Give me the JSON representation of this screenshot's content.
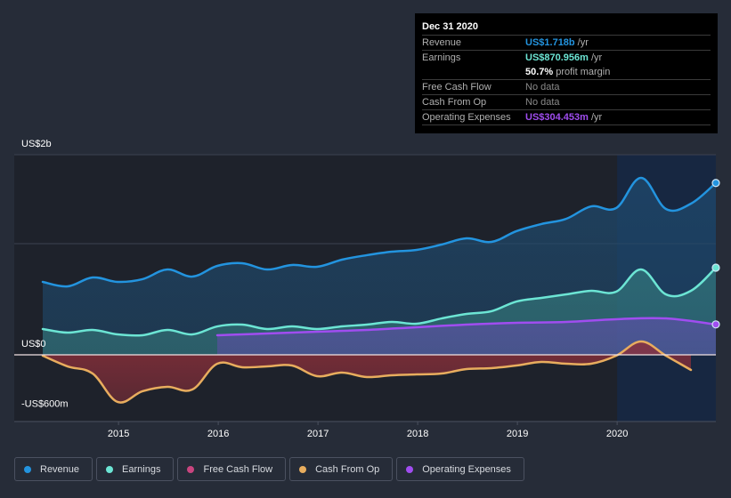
{
  "tooltip": {
    "date": "Dec 31 2020",
    "rows": [
      {
        "label": "Revenue",
        "value": "US$1.718b",
        "unit": "/yr",
        "color": "#2394df"
      },
      {
        "label": "Earnings",
        "value": "US$870.956m",
        "unit": "/yr",
        "color": "#6ce5d4"
      },
      {
        "label": "",
        "value": "50.7%",
        "unit": "profit margin",
        "color": "#ffffff"
      },
      {
        "label": "Free Cash Flow",
        "value": "No data",
        "unit": "",
        "color": "#8a8a8a"
      },
      {
        "label": "Cash From Op",
        "value": "No data",
        "unit": "",
        "color": "#8a8a8a"
      },
      {
        "label": "Operating Expenses",
        "value": "US$304.453m",
        "unit": "/yr",
        "color": "#a04df0"
      }
    ]
  },
  "legend": [
    {
      "label": "Revenue",
      "color": "#2394df"
    },
    {
      "label": "Earnings",
      "color": "#6ce5d4"
    },
    {
      "label": "Free Cash Flow",
      "color": "#c9457f"
    },
    {
      "label": "Cash From Op",
      "color": "#e8ad5e"
    },
    {
      "label": "Operating Expenses",
      "color": "#a04df0"
    }
  ],
  "chart_data": {
    "type": "line",
    "title": "",
    "xlabel": "",
    "ylabel": "",
    "y_unit": "US$ billions",
    "ylim": [
      -0.667,
      2.0
    ],
    "xlim": [
      2014.24,
      2020.99
    ],
    "y_tick_labels": [
      {
        "value": 2.0,
        "label": "US$2b"
      },
      {
        "value": 0.0,
        "label": "US$0"
      },
      {
        "value": -0.6,
        "label": "-US$600m"
      }
    ],
    "gridlines": [
      2.0,
      1.111,
      0.0
    ],
    "x_ticks": [
      2015,
      2016,
      2017,
      2018,
      2019,
      2020
    ],
    "forecast_region_start": 2020.0,
    "highlight_date": "Dec 31 2020",
    "series": [
      {
        "name": "Revenue",
        "color": "#2394df",
        "x": [
          2014.24,
          2014.49,
          2014.74,
          2014.99,
          2015.24,
          2015.49,
          2015.74,
          2015.99,
          2016.24,
          2016.49,
          2016.74,
          2016.99,
          2017.24,
          2017.49,
          2017.74,
          2017.99,
          2018.24,
          2018.49,
          2018.74,
          2018.99,
          2019.24,
          2019.49,
          2019.74,
          2019.99,
          2020.24,
          2020.49,
          2020.74,
          2020.99
        ],
        "values": [
          0.729,
          0.684,
          0.773,
          0.729,
          0.756,
          0.853,
          0.782,
          0.889,
          0.916,
          0.853,
          0.898,
          0.88,
          0.951,
          0.996,
          1.031,
          1.049,
          1.102,
          1.164,
          1.129,
          1.236,
          1.307,
          1.36,
          1.484,
          1.467,
          1.769,
          1.458,
          1.511,
          1.718
        ]
      },
      {
        "name": "Earnings",
        "color": "#6ce5d4",
        "x": [
          2014.24,
          2014.49,
          2014.74,
          2014.99,
          2015.24,
          2015.49,
          2015.74,
          2015.99,
          2016.24,
          2016.49,
          2016.74,
          2016.99,
          2017.24,
          2017.49,
          2017.74,
          2017.99,
          2018.24,
          2018.49,
          2018.74,
          2018.99,
          2019.24,
          2019.49,
          2019.74,
          2019.99,
          2020.24,
          2020.49,
          2020.74,
          2020.99
        ],
        "values": [
          0.258,
          0.222,
          0.249,
          0.204,
          0.196,
          0.249,
          0.204,
          0.284,
          0.302,
          0.258,
          0.284,
          0.258,
          0.284,
          0.302,
          0.329,
          0.311,
          0.364,
          0.409,
          0.436,
          0.533,
          0.569,
          0.604,
          0.64,
          0.631,
          0.853,
          0.604,
          0.64,
          0.871
        ]
      },
      {
        "name": "Free Cash Flow",
        "color": "#c9457f",
        "x": [],
        "values": []
      },
      {
        "name": "Cash From Op",
        "color": "#e8ad5e",
        "x": [
          2014.24,
          2014.49,
          2014.74,
          2014.99,
          2015.24,
          2015.49,
          2015.74,
          2015.99,
          2016.24,
          2016.49,
          2016.74,
          2016.99,
          2017.24,
          2017.49,
          2017.74,
          2017.99,
          2018.24,
          2018.49,
          2018.74,
          2018.99,
          2019.24,
          2019.49,
          2019.74,
          2019.99,
          2020.24,
          2020.49,
          2020.74
        ],
        "values": [
          -0.009,
          -0.116,
          -0.187,
          -0.471,
          -0.364,
          -0.32,
          -0.347,
          -0.089,
          -0.124,
          -0.116,
          -0.107,
          -0.213,
          -0.178,
          -0.222,
          -0.204,
          -0.196,
          -0.187,
          -0.142,
          -0.133,
          -0.107,
          -0.071,
          -0.089,
          -0.089,
          -0.009,
          0.133,
          -0.009,
          -0.151
        ]
      },
      {
        "name": "Operating Expenses",
        "color": "#a04df0",
        "x": [
          2015.99,
          2016.49,
          2016.99,
          2017.49,
          2017.99,
          2018.49,
          2018.99,
          2019.49,
          2019.99,
          2020.49,
          2020.99
        ],
        "values": [
          0.196,
          0.213,
          0.231,
          0.249,
          0.276,
          0.302,
          0.32,
          0.329,
          0.356,
          0.364,
          0.304
        ]
      }
    ]
  }
}
